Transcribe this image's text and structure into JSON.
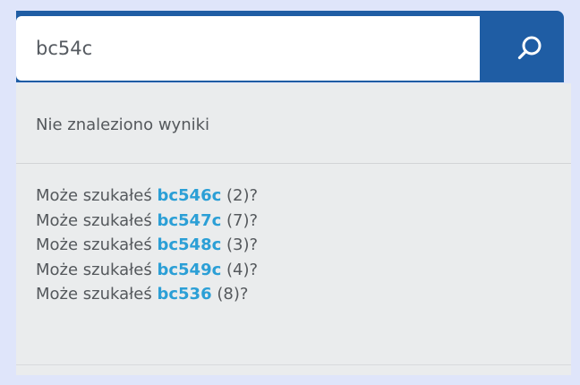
{
  "search": {
    "query": "bc54c",
    "button_icon": "search-icon"
  },
  "results": {
    "no_results_text": "Nie znaleziono wyniki",
    "suggestions": [
      {
        "prefix": "Może szukałeś",
        "term": "bc546c",
        "count": "(2)?"
      },
      {
        "prefix": "Może szukałeś",
        "term": "bc547c",
        "count": "(7)?"
      },
      {
        "prefix": "Może szukałeś",
        "term": "bc548c",
        "count": "(3)?"
      },
      {
        "prefix": "Może szukałeś",
        "term": "bc549c",
        "count": "(4)?"
      },
      {
        "prefix": "Może szukałeś",
        "term": "bc536",
        "count": "(8)?"
      }
    ]
  },
  "colors": {
    "accent": "#1f5da4",
    "link": "#2b9fd6",
    "page_background": "#dfe5fa",
    "panel_background": "#eaeced",
    "text": "#54585c"
  }
}
